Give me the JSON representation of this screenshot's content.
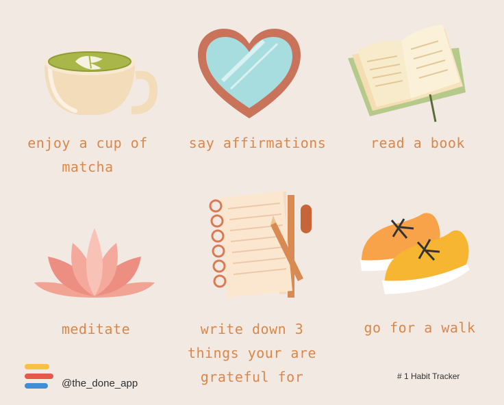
{
  "items": [
    {
      "caption": "enjoy a cup of\nmatcha",
      "icon": "matcha-cup-icon"
    },
    {
      "caption": "say affirmations",
      "icon": "heart-mirror-icon"
    },
    {
      "caption": "read a book",
      "icon": "open-book-icon"
    },
    {
      "caption": "meditate",
      "icon": "lotus-icon"
    },
    {
      "caption": "write down 3\nthings your are\ngrateful for",
      "icon": "notebook-pen-icon"
    },
    {
      "caption": "go for a walk",
      "icon": "sneakers-icon"
    }
  ],
  "footer": {
    "handle": "@the_done_app",
    "tagline": "# 1 Habit Tracker",
    "logo_icon": "done-app-logo-icon"
  },
  "colors": {
    "background": "#f3e9e3",
    "caption": "#d9874a",
    "logo_yellow": "#f6c145",
    "logo_red": "#e8574c",
    "logo_blue": "#3f8fd6"
  }
}
